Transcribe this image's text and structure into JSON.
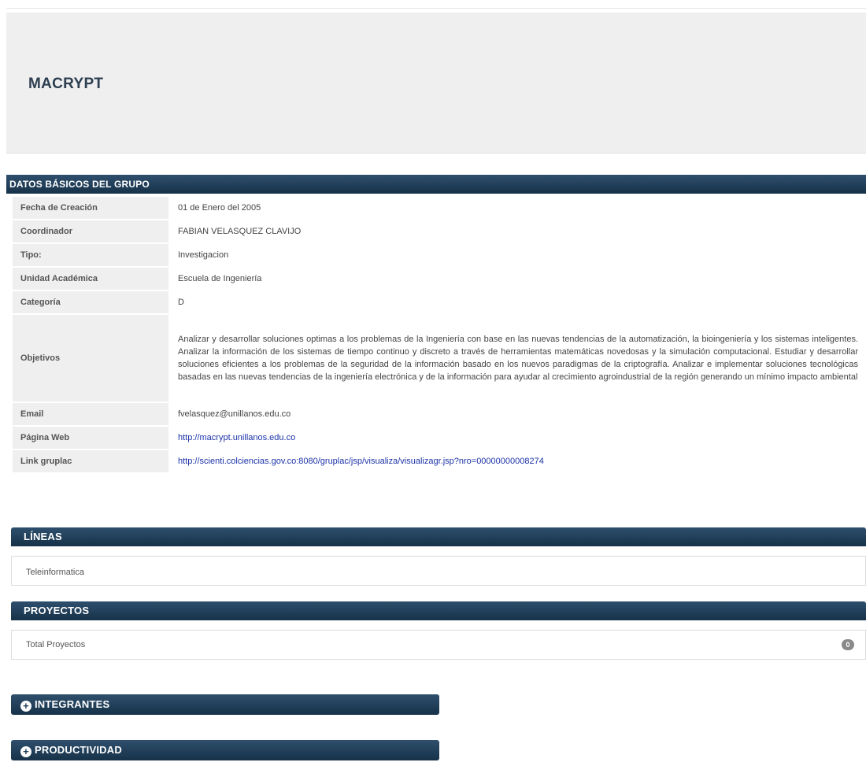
{
  "group": {
    "title": "MACRYPT"
  },
  "basic": {
    "header": "DATOS BÁSICOS DEL GRUPO",
    "rows": [
      {
        "label": "Fecha de Creación",
        "value": "01 de Enero del 2005"
      },
      {
        "label": "Coordinador",
        "value": "FABIAN VELASQUEZ CLAVIJO"
      },
      {
        "label": "Tipo:",
        "value": "Investigacion"
      },
      {
        "label": "Unidad Académica",
        "value": "Escuela de Ingeniería"
      },
      {
        "label": "Categoría",
        "value": "D"
      },
      {
        "label": "Objetivos",
        "value": "Analizar y desarrollar soluciones optimas a los problemas de la Ingeniería con base en las nuevas tendencias de la automatización, la bioingeniería y los sistemas inteligentes. Analizar la información de los sistemas de tiempo continuo y discreto a través de herramientas matemáticas novedosas y la simulación computacional. Estudiar y desarrollar soluciones eficientes a los problemas de la seguridad de la información basado en los nuevos paradigmas de la criptografía. Analizar e implementar soluciones tecnológicas basadas en las nuevas tendencias de la ingeniería electrónica y de la información para ayudar al crecimiento agroindustrial de la región generando un mínimo impacto ambiental"
      },
      {
        "label": "Email",
        "value": "fvelasquez@unillanos.edu.co"
      },
      {
        "label": "Página Web",
        "value": "http://macrypt.unillanos.edu.co"
      },
      {
        "label": "Link gruplac",
        "value": "http://scienti.colciencias.gov.co:8080/gruplac/jsp/visualiza/visualizagr.jsp?nro=00000000008274"
      }
    ]
  },
  "lineas": {
    "header": "LÍNEAS",
    "items": [
      "Teleinformatica"
    ]
  },
  "proyectos": {
    "header": "PROYECTOS",
    "total_label": "Total Proyectos",
    "total_count": "0"
  },
  "integrantes": {
    "header": "INTEGRANTES",
    "icon": "plus-circle-icon"
  },
  "productividad": {
    "header": "PRODUCTIVIDAD",
    "icon": "plus-circle-icon"
  }
}
